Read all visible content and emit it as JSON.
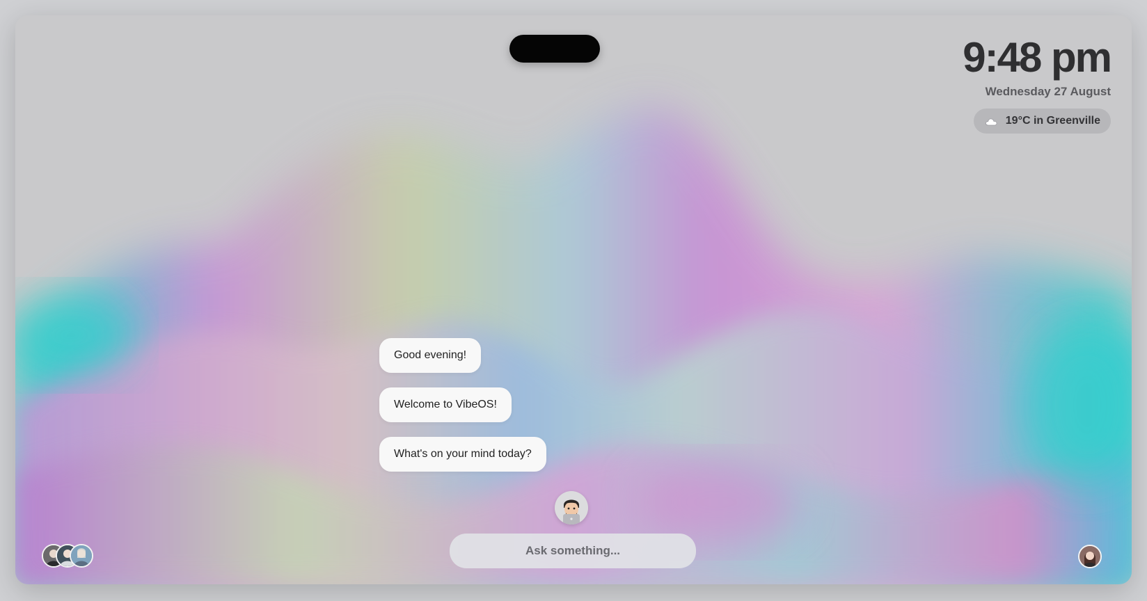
{
  "clock": {
    "time": "9:48 pm",
    "date": "Wednesday 27 August"
  },
  "weather": {
    "icon": "cloud-icon",
    "text": "19°C in Greenville"
  },
  "chat": {
    "messages": [
      "Good evening!",
      "Welcome to VibeOS!",
      "What's on your mind today?"
    ]
  },
  "input": {
    "placeholder": "Ask something..."
  },
  "colors": {
    "wallpaper_base": "#c9c9cb",
    "accent_purple": "#c98fd6",
    "accent_cyan": "#2fd0cc"
  }
}
